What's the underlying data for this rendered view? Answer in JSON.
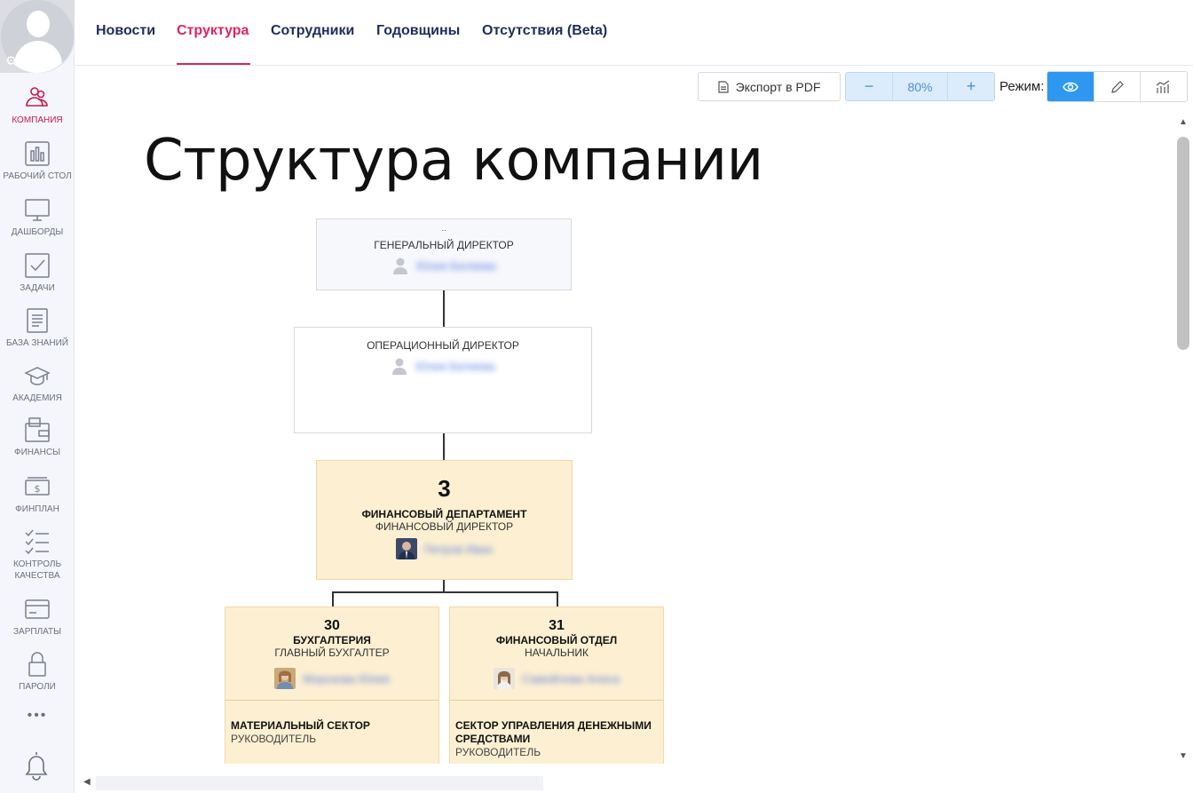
{
  "sidebar": {
    "items": [
      {
        "label": "КОМПАНИЯ",
        "icon": "company-icon",
        "active": true
      },
      {
        "label": "РАБОЧИЙ СТОЛ",
        "icon": "desktop-icon"
      },
      {
        "label": "ДАШБОРДЫ",
        "icon": "monitor-icon"
      },
      {
        "label": "ЗАДАЧИ",
        "icon": "checkbox-icon"
      },
      {
        "label": "БАЗА ЗНАНИЙ",
        "icon": "document-icon"
      },
      {
        "label": "АКАДЕМИЯ",
        "icon": "graduation-cap-icon"
      },
      {
        "label": "ФИНАНСЫ",
        "icon": "wallet-icon"
      },
      {
        "label": "ФИНПЛАН",
        "icon": "money-icon"
      },
      {
        "label": "КОНТРОЛЬ КАЧЕСТВА",
        "icon": "checklist-icon"
      },
      {
        "label": "ЗАРПЛАТЫ",
        "icon": "card-icon"
      },
      {
        "label": "ПАРОЛИ",
        "icon": "lock-icon"
      }
    ],
    "more": "•••"
  },
  "tabs": [
    "Новости",
    "Структура",
    "Сотрудники",
    "Годовщины",
    "Отсутствия (Beta)"
  ],
  "toolbar": {
    "export_label": "Экспорт в PDF",
    "zoom_minus": "−",
    "zoom_value": "80%",
    "zoom_plus": "+",
    "mode_label": "Режим:"
  },
  "page_title": "Структура компании",
  "org": {
    "ceo": {
      "dots": "..",
      "role": "ГЕНЕРАЛЬНЫЙ ДИРЕКТОР",
      "person": "Юлия Беляева"
    },
    "coo": {
      "role": "ОПЕРАЦИОННЫЙ ДИРЕКТОР",
      "person": "Юлия Беляева"
    },
    "finance": {
      "num": "3",
      "dept": "ФИНАНСОВЫЙ ДЕПАРТАМЕНТ",
      "role": "ФИНАНСОВЫЙ ДИРЕКТОР",
      "person": "Петров Иван"
    },
    "accounting": {
      "num": "30",
      "dept": "БУХГАЛТЕРИЯ",
      "role": "ГЛАВНЫЙ БУХГАЛТЕР",
      "person": "Морозова Юлия",
      "sub_title": "МАТЕРИАЛЬНЫЙ СЕКТОР",
      "sub_role": "РУКОВОДИТЕЛЬ"
    },
    "fin_dept": {
      "num": "31",
      "dept": "ФИНАНСОВЫЙ ОТДЕЛ",
      "role": "НАЧАЛЬНИК",
      "person": "Самойлова Алиса",
      "sub_title": "СЕКТОР УПРАВЛЕНИЯ ДЕНЕЖНЫМИ СРЕДСТВАМИ",
      "sub_role": "РУКОВОДИТЕЛЬ"
    }
  },
  "colors": {
    "accent": "#e0245e",
    "nav": "#1f2d5c",
    "mode_active": "#2e98f0",
    "dept_bg": "#fdf0d2"
  }
}
